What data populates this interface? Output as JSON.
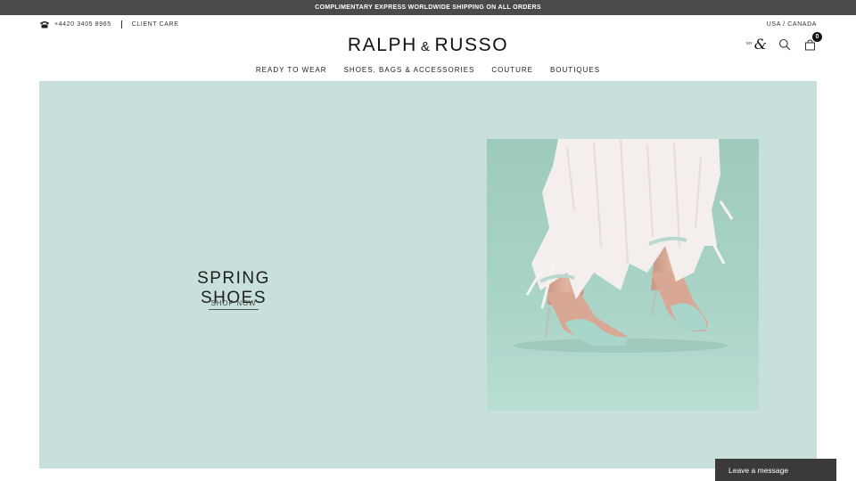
{
  "promo": {
    "text": "COMPLIMENTARY EXPRESS WORLDWIDE SHIPPING ON ALL ORDERS"
  },
  "utility": {
    "phone": "+4420 3405 8965",
    "client_care": "CLIENT CARE",
    "region": "USA / CANADA"
  },
  "logo": {
    "left": "RALPH",
    "amp": "&",
    "right": "RUSSO"
  },
  "account": {
    "my": "MY",
    "mark": "&"
  },
  "bag": {
    "count": "0"
  },
  "nav": {
    "items": [
      {
        "label": "READY TO WEAR"
      },
      {
        "label": "SHOES, BAGS & ACCESSORIES"
      },
      {
        "label": "COUTURE"
      },
      {
        "label": "BOUTIQUES"
      }
    ]
  },
  "hero": {
    "title": "SPRING SHOES",
    "cta": "SHOP NOW"
  },
  "chat": {
    "label": "Leave a message"
  },
  "colors": {
    "promo_bg": "#4a4a4a",
    "hero_bg": "#c8e0dc",
    "chat_bg": "#3a3a3a"
  },
  "icons": [
    "phone-icon",
    "search-icon",
    "shopping-bag-icon"
  ]
}
